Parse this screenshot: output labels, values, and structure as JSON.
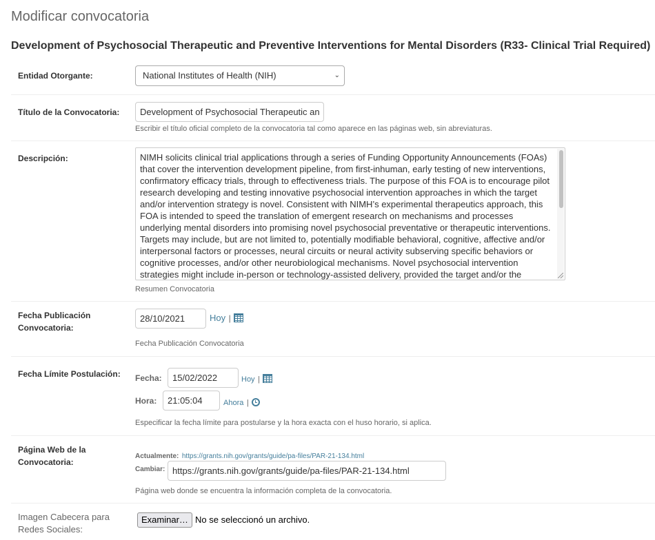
{
  "page_title": "Modificar convocatoria",
  "grant_title": "Development of Psychosocial Therapeutic and Preventive Interventions for Mental Disorders (R33- Clinical Trial Required)",
  "entity": {
    "label": "Entidad Otorgante:",
    "value": "National Institutes of Health (NIH)"
  },
  "title_field": {
    "label": "Título de la Convocatoria:",
    "value": "Development of Psychosocial Therapeutic an",
    "help": "Escribir el título oficial completo de la convocatoria tal como aparece en las páginas web, sin abreviaturas."
  },
  "description": {
    "label": "Descripción:",
    "value": "NIMH solicits clinical trial applications through a series of Funding Opportunity Announcements (FOAs) that cover the intervention development pipeline, from first-inhuman, early testing of new interventions, confirmatory efficacy trials, through to effectiveness trials. The purpose of this FOA is to encourage pilot research developing and testing innovative psychosocial intervention approaches in which the target and/or intervention strategy is novel. Consistent with NIMH’s experimental therapeutics approach, this FOA is intended to speed the translation of emergent research on mechanisms and processes underlying mental disorders into promising novel psychosocial preventative or therapeutic interventions. Targets may include, but are not limited to, potentially modifiable behavioral, cognitive, affective and/or interpersonal factors or processes, neural circuits or neural activity subserving specific behaviors or cognitive processes, and/or other neurobiological mechanisms. Novel psychosocial intervention strategies might include in-person or technology-assisted delivery, provided the target and/or the",
    "help": "Resumen Convocatoria"
  },
  "pub_date": {
    "label": "Fecha Publicación Convocatoria:",
    "value": "28/10/2021",
    "today_link": "Hoy",
    "separator": "|",
    "help": "Fecha Publicación Convocatoria"
  },
  "deadline": {
    "label": "Fecha Límite Postulación:",
    "date_label": "Fecha:",
    "date_value": "15/02/2022",
    "today_link": "Hoy",
    "time_label": "Hora:",
    "time_value": "21:05:04",
    "now_link": "Ahora",
    "separator": "|",
    "help": "Especificar la fecha límite para postularse y la hora exacta con el huso horario, si aplica."
  },
  "webpage": {
    "label": "Página Web de la Convocatoria:",
    "current_label": "Actualmente:",
    "current_url": "https://grants.nih.gov/grants/guide/pa-files/PAR-21-134.html",
    "change_label": "Cambiar:",
    "change_value": "https://grants.nih.gov/grants/guide/pa-files/PAR-21-134.html",
    "help": "Página web donde se encuentra la información completa de la convocatoria."
  },
  "header_image": {
    "label": "Imagen Cabecera para Redes Sociales:",
    "button": "Examinar…",
    "status": "No se seleccionó un archivo."
  },
  "colors": {
    "link": "#447e9b",
    "label": "#333333",
    "muted": "#666666"
  }
}
